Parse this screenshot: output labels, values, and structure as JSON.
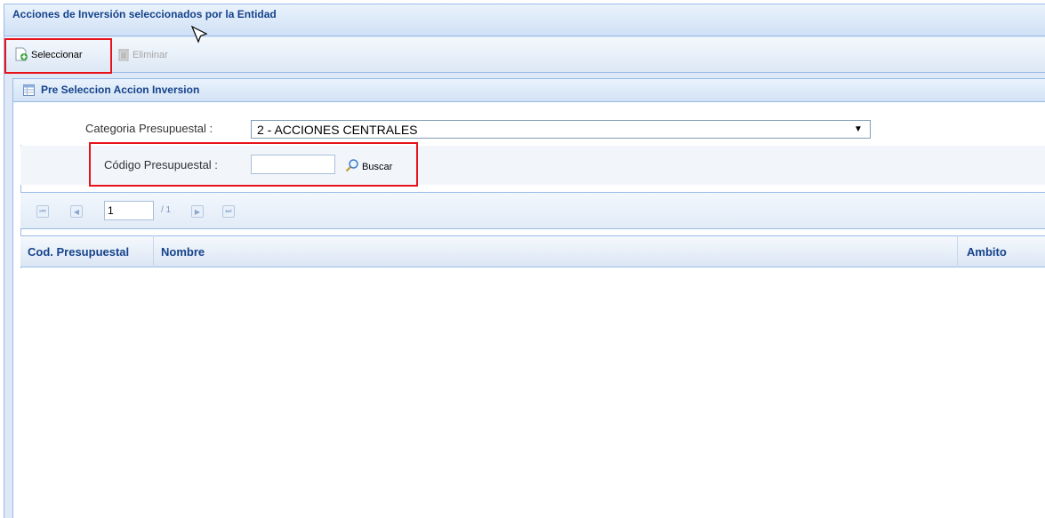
{
  "window": {
    "title": "Acciones de Inversión seleccionados por la Entidad"
  },
  "toolbar": {
    "seleccionar_label": "Seleccionar",
    "eliminar_label": "Eliminar"
  },
  "panel": {
    "title": "Pre Seleccion Accion Inversion"
  },
  "form": {
    "categoria_label": "Categoria Presupuestal :",
    "categoria_value": "2 - ACCIONES CENTRALES",
    "codigo_label": "Código Presupuestal :",
    "codigo_value": "",
    "buscar_label": "Buscar"
  },
  "pager": {
    "current_page": "1",
    "total": "/ 1"
  },
  "grid": {
    "columns": [
      "Cod. Presupuestal",
      "Nombre",
      "Ambito"
    ],
    "rows": []
  },
  "colors": {
    "highlight": "#e8121b",
    "header_text": "#15428b",
    "border": "#99bbe8"
  },
  "icons": [
    "add-document-icon",
    "trash-icon",
    "grid-icon",
    "magnifier-icon",
    "first-page-icon",
    "prev-page-icon",
    "next-page-icon",
    "last-page-icon",
    "mouse-cursor-icon"
  ]
}
